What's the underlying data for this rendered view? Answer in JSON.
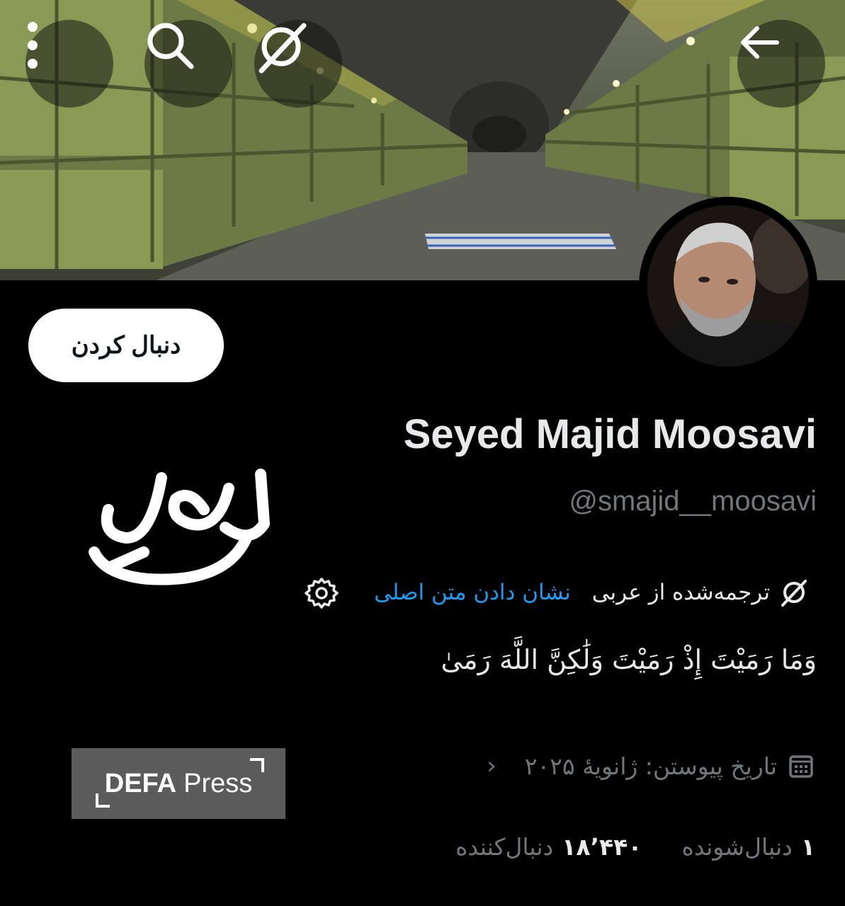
{
  "header": {
    "back_icon": "arrow-left-icon",
    "grok_icon": "grok-icon",
    "search_icon": "search-icon",
    "more_icon": "more-vertical-icon"
  },
  "profile": {
    "follow_label": "دنبال کردن",
    "display_name": "Seyed Majid Moosavi",
    "handle": "@smajid__moosavi",
    "translated_from": "ترجمه‌شده از عربی",
    "show_original": "نشان دادن متن اصلی",
    "bio": "وَمَا رَمَيْتَ إِذْ رَمَيْتَ وَلَٰكِنَّ اللَّهَ رَمَىٰ",
    "joined": "تاریخ پیوستن: ژانویهٔ ۲۰۲۵",
    "following_count": "۱",
    "following_label": "دنبال‌شونده",
    "followers_count": "۱۸٬۴۴۰",
    "followers_label": "دنبال‌کننده"
  },
  "overlay": {
    "fake_label": "جعلی",
    "watermark_bold": "DEFA",
    "watermark_rest": "Press"
  },
  "colors": {
    "background": "#000000",
    "link": "#1d9bf0",
    "muted": "#71767b",
    "text": "#e7e9ea"
  }
}
